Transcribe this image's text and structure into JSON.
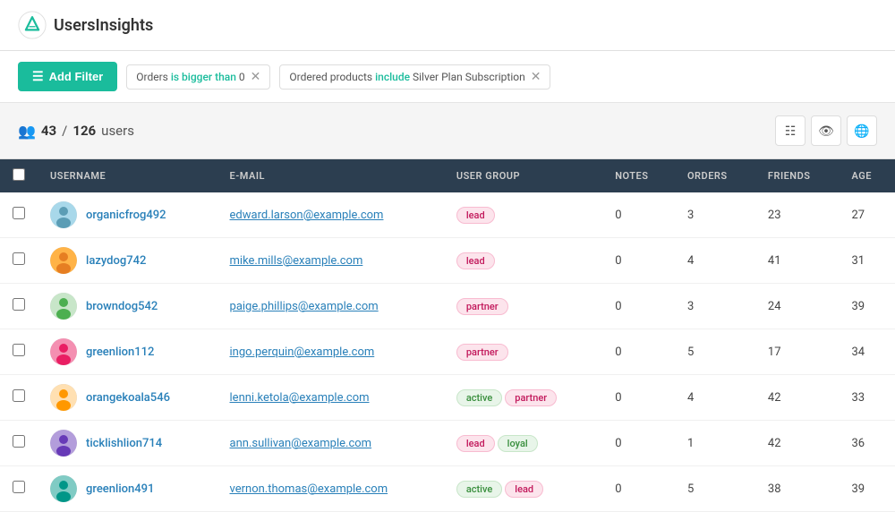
{
  "header": {
    "logo_text": "UsersInsights"
  },
  "filters": {
    "add_button_label": "Add Filter",
    "filter1": {
      "text": "Orders is bigger than 0",
      "parts": [
        "Orders ",
        "is bigger than",
        " 0"
      ]
    },
    "filter2": {
      "text": "Ordered products include Silver Plan Subscription",
      "parts": [
        "Ordered products ",
        "include",
        " Silver Plan Subscription"
      ]
    }
  },
  "stats": {
    "count": "43",
    "total": "126",
    "label": "users"
  },
  "table": {
    "columns": [
      "USERNAME",
      "E-MAIL",
      "USER GROUP",
      "NOTES",
      "ORDERS",
      "FRIENDS",
      "AGE"
    ],
    "rows": [
      {
        "username": "organicfrog492",
        "email": "edward.larson@example.com",
        "groups": [
          {
            "label": "lead",
            "type": "lead"
          }
        ],
        "notes": "0",
        "orders": "3",
        "friends": "23",
        "age": "27"
      },
      {
        "username": "lazydog742",
        "email": "mike.mills@example.com",
        "groups": [
          {
            "label": "lead",
            "type": "lead"
          }
        ],
        "notes": "0",
        "orders": "4",
        "friends": "41",
        "age": "31"
      },
      {
        "username": "browndog542",
        "email": "paige.phillips@example.com",
        "groups": [
          {
            "label": "partner",
            "type": "partner"
          }
        ],
        "notes": "0",
        "orders": "3",
        "friends": "24",
        "age": "39"
      },
      {
        "username": "greenlion112",
        "email": "ingo.perquin@example.com",
        "groups": [
          {
            "label": "partner",
            "type": "partner"
          }
        ],
        "notes": "0",
        "orders": "5",
        "friends": "17",
        "age": "34"
      },
      {
        "username": "orangekoala546",
        "email": "lenni.ketola@example.com",
        "groups": [
          {
            "label": "active",
            "type": "active"
          },
          {
            "label": "partner",
            "type": "partner"
          }
        ],
        "notes": "0",
        "orders": "4",
        "friends": "42",
        "age": "33"
      },
      {
        "username": "ticklishlion714",
        "email": "ann.sullivan@example.com",
        "groups": [
          {
            "label": "lead",
            "type": "lead"
          },
          {
            "label": "loyal",
            "type": "loyal"
          }
        ],
        "notes": "0",
        "orders": "1",
        "friends": "42",
        "age": "36"
      },
      {
        "username": "greenlion491",
        "email": "vernon.thomas@example.com",
        "groups": [
          {
            "label": "active",
            "type": "active"
          },
          {
            "label": "lead",
            "type": "lead"
          }
        ],
        "notes": "0",
        "orders": "5",
        "friends": "38",
        "age": "39"
      }
    ]
  },
  "view_buttons": [
    {
      "icon": "grid",
      "label": "Grid view"
    },
    {
      "icon": "eye",
      "label": "Columns view"
    },
    {
      "icon": "globe",
      "label": "Map view"
    }
  ]
}
